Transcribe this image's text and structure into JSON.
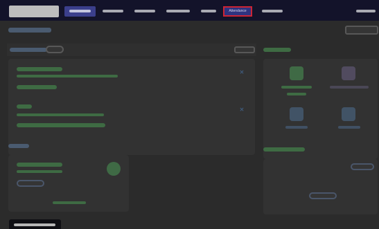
{
  "nav": {
    "highlighted_item_label": "Attendance"
  },
  "colors": {
    "navbar_bg": "#13132a",
    "active_nav_bg": "#3b3f8c",
    "highlight_outline": "#cc2535",
    "overlay_dim": "#2b2b2b",
    "accent_green": "#3e6b43",
    "accent_blue": "#4a5b70"
  },
  "icons": {
    "card_close": "close-icon",
    "tile_1": "app-tile-icon",
    "tile_2": "app-tile-icon",
    "tile_3": "app-tile-icon",
    "tile_4": "app-tile-icon",
    "status": "status-circle-icon"
  }
}
